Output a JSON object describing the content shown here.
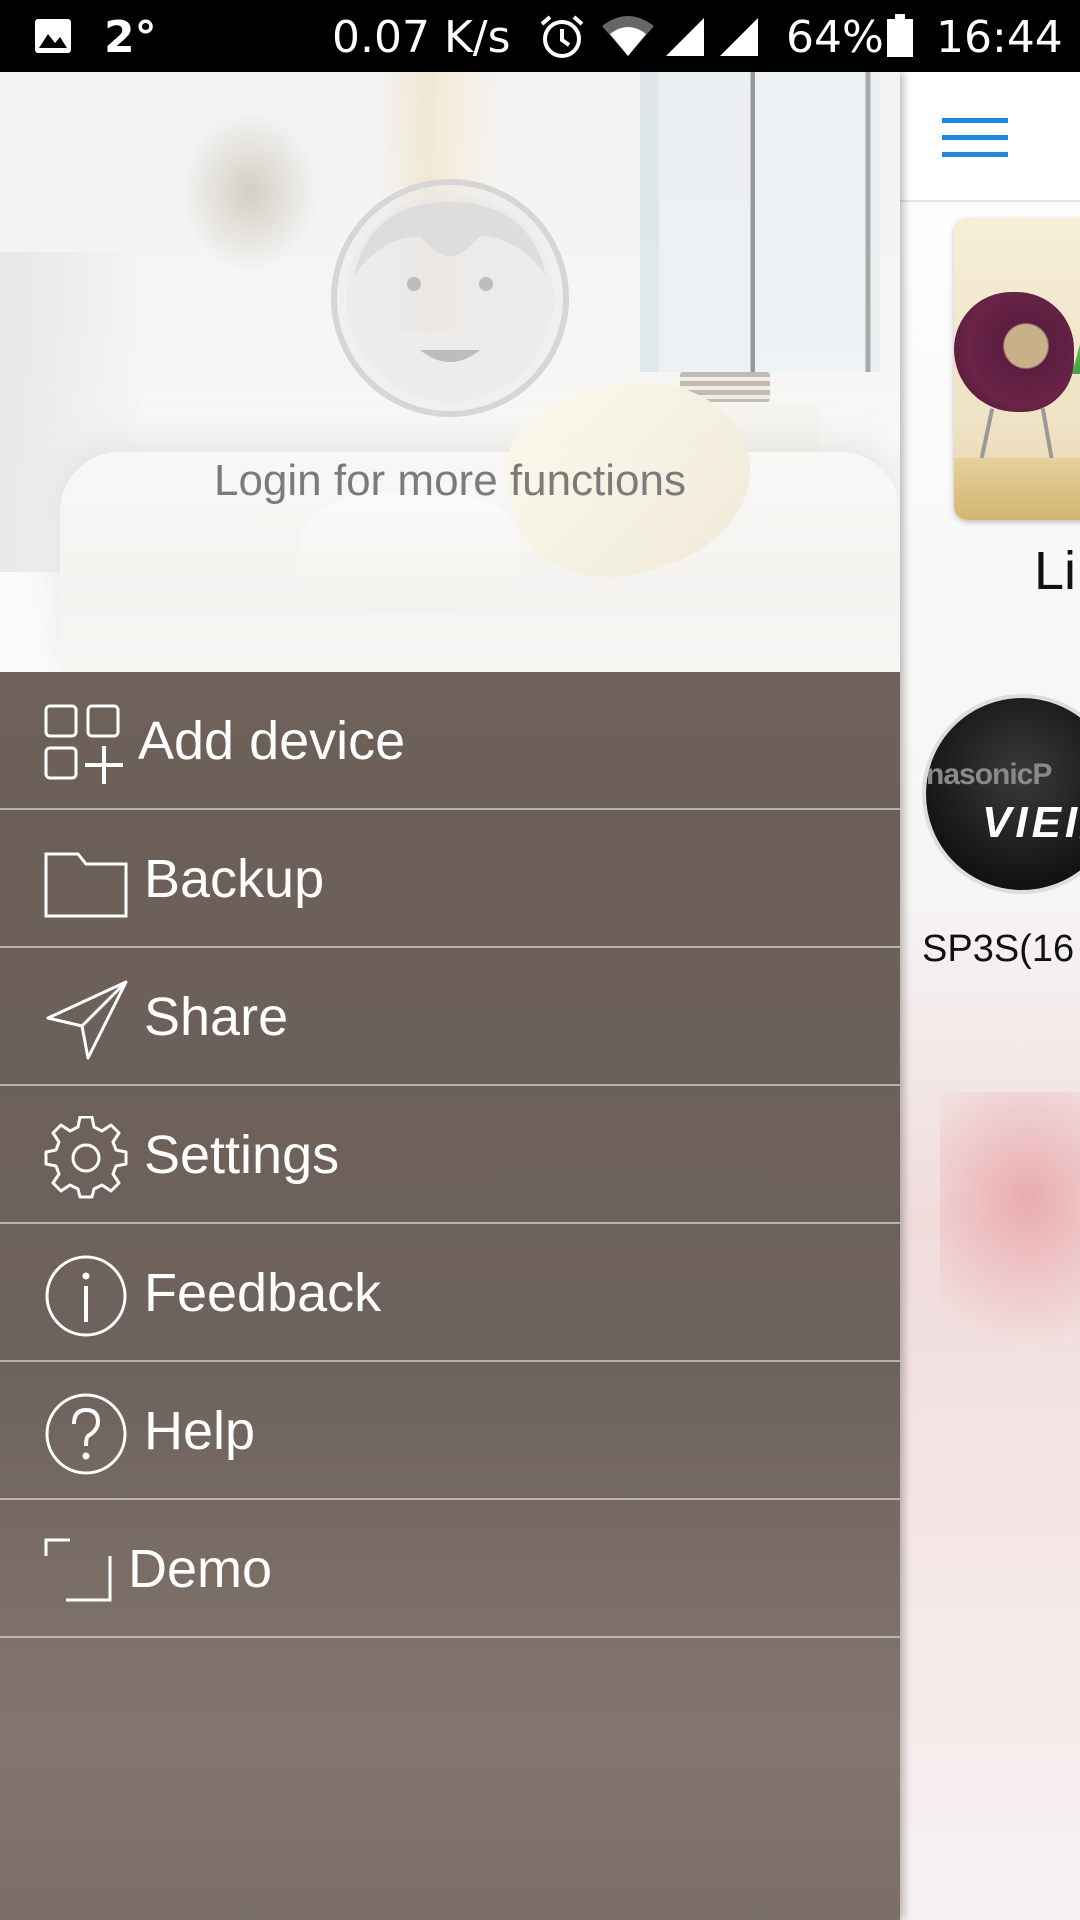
{
  "status_bar": {
    "temperature": "2°",
    "net_speed": "0.07 K/s",
    "battery_percent": "64%",
    "time": "16:44",
    "icons": [
      "gallery-icon",
      "alarm-icon",
      "wifi-icon",
      "signal-icon",
      "signal-icon",
      "battery-icon"
    ]
  },
  "drawer": {
    "login_prompt": "Login for more functions",
    "menu": [
      {
        "label": "Add device",
        "icon": "add-device-icon"
      },
      {
        "label": "Backup",
        "icon": "folder-icon"
      },
      {
        "label": "Share",
        "icon": "send-icon"
      },
      {
        "label": "Settings",
        "icon": "gear-icon"
      },
      {
        "label": "Feedback",
        "icon": "info-icon"
      },
      {
        "label": "Help",
        "icon": "help-icon"
      },
      {
        "label": "Demo",
        "icon": "demo-icon"
      }
    ]
  },
  "background_app": {
    "room_label": "Li",
    "device_brand_left": "nasonic",
    "device_brand_right": "P",
    "device_logo": "VIEI/",
    "device_name": "SP3S(16"
  },
  "colors": {
    "accent": "#1e88e5",
    "drawer_bg": "#6e625c",
    "divider": "#d2cdc8"
  }
}
